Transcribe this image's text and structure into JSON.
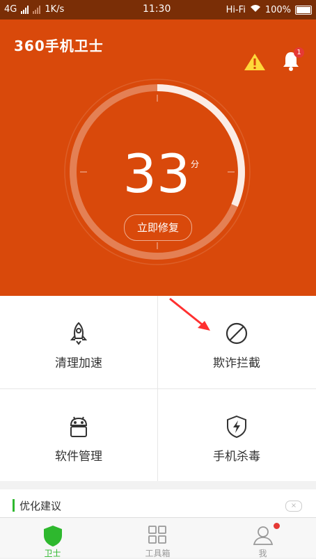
{
  "status_bar": {
    "network": "4G",
    "speed": "1K/s",
    "time": "11:30",
    "wifi_label": "Hi-Fi",
    "battery": "100%"
  },
  "header": {
    "app_title": "360手机卫士",
    "notification_count": "1"
  },
  "score": {
    "value": "33",
    "unit": "分",
    "fix_button": "立即修复"
  },
  "features": [
    {
      "label": "清理加速",
      "icon": "rocket-icon"
    },
    {
      "label": "欺诈拦截",
      "icon": "block-icon"
    },
    {
      "label": "软件管理",
      "icon": "android-icon"
    },
    {
      "label": "手机杀毒",
      "icon": "shield-bolt-icon"
    }
  ],
  "suggestion": {
    "title": "优化建议",
    "close": "×"
  },
  "tabs": [
    {
      "label": "卫士",
      "icon": "shield-icon"
    },
    {
      "label": "工具箱",
      "icon": "grid-icon"
    },
    {
      "label": "我",
      "icon": "user-icon"
    }
  ],
  "colors": {
    "brand": "#d9490b",
    "status_bar": "#7a2e06",
    "accent_green": "#2eb82e",
    "alert_red": "#e53935"
  }
}
